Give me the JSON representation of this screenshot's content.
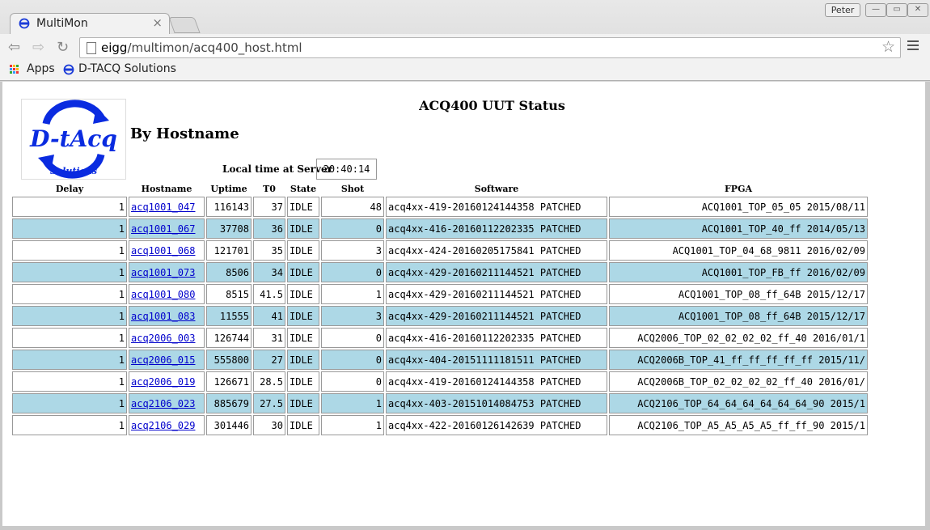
{
  "browser": {
    "tab_title": "MultiMon",
    "tab_close": "×",
    "user": "Peter",
    "url_host": "eigg",
    "url_path": "/multimon/acq400_host.html",
    "bookmarks": [
      "Apps",
      "D-TACQ Solutions"
    ],
    "icons": [
      "back-icon",
      "forward-icon",
      "reload-icon",
      "star-icon",
      "menu-icon"
    ]
  },
  "logo_text": [
    "D-tAcq",
    "Solutions"
  ],
  "page": {
    "title": "ACQ400 UUT Status",
    "subtitle": "By Hostname",
    "local_time_label": "Local time at Server",
    "local_time": "20:40:14"
  },
  "table": {
    "columns": [
      "Delay",
      "Hostname",
      "Uptime",
      "T0",
      "State",
      "Shot",
      "Software",
      "FPGA"
    ],
    "rows": [
      {
        "delay": "1",
        "host": "acq1001_047",
        "uptime": "116143",
        "t0": "37",
        "state": "IDLE",
        "shot": "48",
        "software": "acq4xx-419-20160124144358 PATCHED",
        "fpga": "ACQ1001_TOP_05_05 2015/08/11"
      },
      {
        "delay": "1",
        "host": "acq1001_067",
        "uptime": "37708",
        "t0": "36",
        "state": "IDLE",
        "shot": "0",
        "software": "acq4xx-416-20160112202335 PATCHED",
        "fpga": "ACQ1001_TOP_40_ff 2014/05/13"
      },
      {
        "delay": "1",
        "host": "acq1001_068",
        "uptime": "121701",
        "t0": "35",
        "state": "IDLE",
        "shot": "3",
        "software": "acq4xx-424-20160205175841 PATCHED",
        "fpga": "ACQ1001_TOP_04_68_9811 2016/02/09"
      },
      {
        "delay": "1",
        "host": "acq1001_073",
        "uptime": "8506",
        "t0": "34",
        "state": "IDLE",
        "shot": "0",
        "software": "acq4xx-429-20160211144521 PATCHED",
        "fpga": "ACQ1001_TOP_FB_ff 2016/02/09"
      },
      {
        "delay": "1",
        "host": "acq1001_080",
        "uptime": "8515",
        "t0": "41.5",
        "state": "IDLE",
        "shot": "1",
        "software": "acq4xx-429-20160211144521 PATCHED",
        "fpga": "ACQ1001_TOP_08_ff_64B 2015/12/17"
      },
      {
        "delay": "1",
        "host": "acq1001_083",
        "uptime": "11555",
        "t0": "41",
        "state": "IDLE",
        "shot": "3",
        "software": "acq4xx-429-20160211144521 PATCHED",
        "fpga": "ACQ1001_TOP_08_ff_64B 2015/12/17"
      },
      {
        "delay": "1",
        "host": "acq2006_003",
        "uptime": "126744",
        "t0": "31",
        "state": "IDLE",
        "shot": "0",
        "software": "acq4xx-416-20160112202335 PATCHED",
        "fpga": "ACQ2006_TOP_02_02_02_02_ff_40 2016/01/1"
      },
      {
        "delay": "1",
        "host": "acq2006_015",
        "uptime": "555800",
        "t0": "27",
        "state": "IDLE",
        "shot": "0",
        "software": "acq4xx-404-20151111181511 PATCHED",
        "fpga": "ACQ2006B_TOP_41_ff_ff_ff_ff_ff 2015/11/"
      },
      {
        "delay": "1",
        "host": "acq2006_019",
        "uptime": "126671",
        "t0": "28.5",
        "state": "IDLE",
        "shot": "0",
        "software": "acq4xx-419-20160124144358 PATCHED",
        "fpga": "ACQ2006B_TOP_02_02_02_02_ff_40 2016/01/"
      },
      {
        "delay": "1",
        "host": "acq2106_023",
        "uptime": "885679",
        "t0": "27.5",
        "state": "IDLE",
        "shot": "1",
        "software": "acq4xx-403-20151014084753 PATCHED",
        "fpga": "ACQ2106_TOP_64_64_64_64_64_64_90 2015/1"
      },
      {
        "delay": "1",
        "host": "acq2106_029",
        "uptime": "301446",
        "t0": "30",
        "state": "IDLE",
        "shot": "1",
        "software": "acq4xx-422-20160126142639 PATCHED",
        "fpga": "ACQ2106_TOP_A5_A5_A5_A5_ff_ff_90 2015/1"
      }
    ]
  },
  "colors": {
    "alt_row": "#add8e6",
    "link": "#0000cc",
    "logo_blue": "#0a2be0"
  }
}
